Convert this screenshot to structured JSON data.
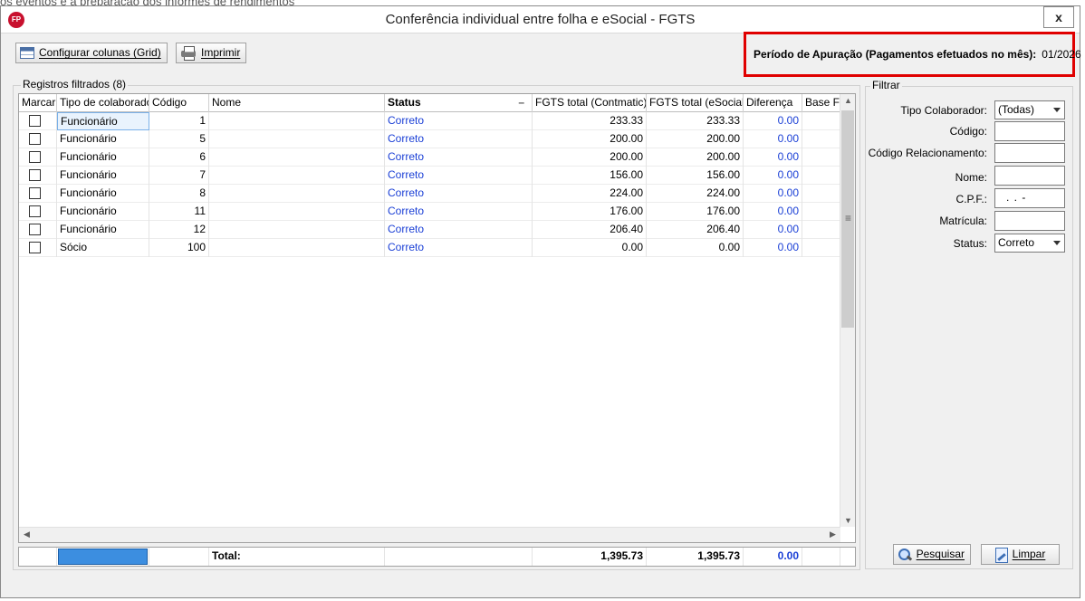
{
  "background_text": "os eventos e a preparação dos informes de rendimentos",
  "window": {
    "title": "Conferência individual entre folha e eSocial - FGTS",
    "app_icon": "FP",
    "close_label": "x"
  },
  "toolbar": {
    "config_label": "Configurar colunas (Grid)",
    "print_label": "Imprimir"
  },
  "periodo": {
    "label": "Período de Apuração (Pagamentos efetuados no mês):",
    "value": "01/2026"
  },
  "grid": {
    "group_label": "Registros filtrados (8)",
    "columns": [
      "Marcar",
      "Tipo de colaborador",
      "Código",
      "Nome",
      "Status",
      "FGTS total (Contmatic)",
      "FGTS total (eSocial)",
      "Diferença",
      "Base FGTS"
    ],
    "rows": [
      {
        "tipo": "Funcionário",
        "codigo": "1",
        "nome": "",
        "status": "Correto",
        "contmatic": "233.33",
        "esocial": "233.33",
        "diferenca": "0.00"
      },
      {
        "tipo": "Funcionário",
        "codigo": "5",
        "nome": "",
        "status": "Correto",
        "contmatic": "200.00",
        "esocial": "200.00",
        "diferenca": "0.00"
      },
      {
        "tipo": "Funcionário",
        "codigo": "6",
        "nome": "",
        "status": "Correto",
        "contmatic": "200.00",
        "esocial": "200.00",
        "diferenca": "0.00"
      },
      {
        "tipo": "Funcionário",
        "codigo": "7",
        "nome": "",
        "status": "Correto",
        "contmatic": "156.00",
        "esocial": "156.00",
        "diferenca": "0.00"
      },
      {
        "tipo": "Funcionário",
        "codigo": "8",
        "nome": "",
        "status": "Correto",
        "contmatic": "224.00",
        "esocial": "224.00",
        "diferenca": "0.00"
      },
      {
        "tipo": "Funcionário",
        "codigo": "11",
        "nome": "",
        "status": "Correto",
        "contmatic": "176.00",
        "esocial": "176.00",
        "diferenca": "0.00"
      },
      {
        "tipo": "Funcionário",
        "codigo": "12",
        "nome": "",
        "status": "Correto",
        "contmatic": "206.40",
        "esocial": "206.40",
        "diferenca": "0.00"
      },
      {
        "tipo": "Sócio",
        "codigo": "100",
        "nome": "",
        "status": "Correto",
        "contmatic": "0.00",
        "esocial": "0.00",
        "diferenca": "0.00"
      }
    ],
    "total_label": "Total:",
    "total_contmatic": "1,395.73",
    "total_esocial": "1,395.73",
    "total_diferenca": "0.00"
  },
  "filter": {
    "group_label": "Filtrar",
    "tipo_label": "Tipo Colaborador:",
    "tipo_value": "(Todas)",
    "codigo_label": "Código:",
    "codigo_rel_label": "Código Relacionamento:",
    "nome_label": "Nome:",
    "cpf_label": "C.P.F.:",
    "cpf_mask": ".   .   -",
    "matricula_label": "Matrícula:",
    "status_label": "Status:",
    "status_value": "Correto",
    "search_label": "Pesquisar",
    "clear_label": "Limpar"
  },
  "colors": {
    "highlight_border": "#e00000",
    "link_blue": "#1a3fd6",
    "total_cell": "#3c8ee0"
  }
}
